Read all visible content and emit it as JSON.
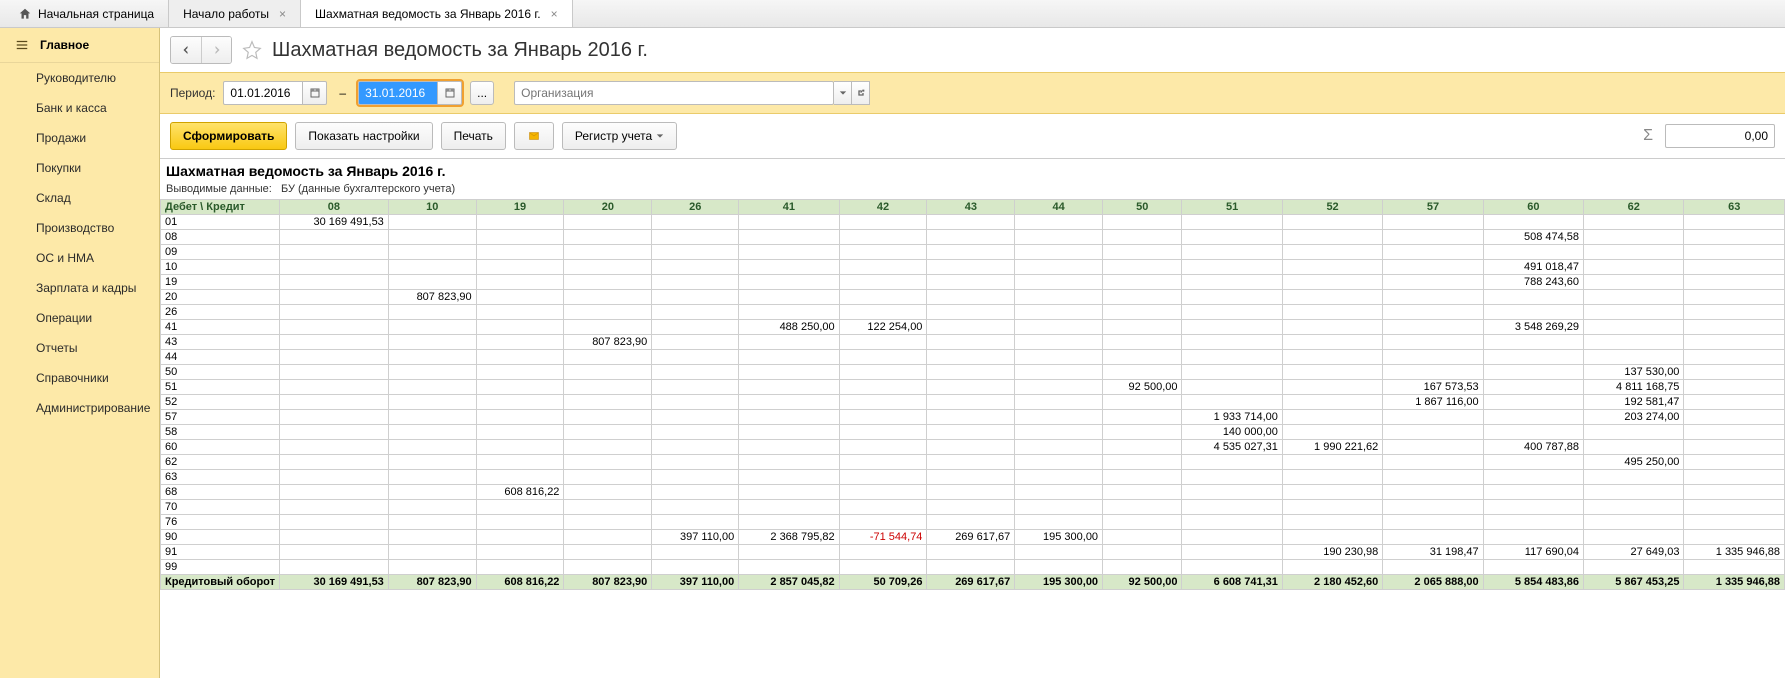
{
  "tabs": {
    "home": "Начальная страница",
    "items": [
      {
        "label": "Начало работы"
      },
      {
        "label": "Шахматная ведомость за Январь 2016 г.",
        "active": true
      }
    ]
  },
  "sidebar": {
    "main": "Главное",
    "items": [
      "Руководителю",
      "Банк и касса",
      "Продажи",
      "Покупки",
      "Склад",
      "Производство",
      "ОС и НМА",
      "Зарплата и кадры",
      "Операции",
      "Отчеты",
      "Справочники",
      "Администрирование"
    ]
  },
  "header": {
    "title": "Шахматная ведомость за Январь 2016 г."
  },
  "filter": {
    "period_label": "Период:",
    "from": "01.01.2016",
    "to": "31.01.2016",
    "org_placeholder": "Организация",
    "ellipsis": "..."
  },
  "toolbar": {
    "form": "Сформировать",
    "settings": "Показать настройки",
    "print": "Печать",
    "register": "Регистр учета",
    "sum": "0,00"
  },
  "report": {
    "title": "Шахматная ведомость за Январь 2016 г.",
    "sub_label": "Выводимые данные:",
    "sub_value": "БУ (данные бухгалтерского учета)",
    "row_header": "Дебет \\ Кредит",
    "columns": [
      "08",
      "10",
      "19",
      "20",
      "26",
      "41",
      "42",
      "43",
      "44",
      "50",
      "51",
      "52",
      "57",
      "60",
      "62",
      "63"
    ],
    "rows": [
      {
        "acc": "01",
        "cells": {
          "08": "30 169 491,53"
        }
      },
      {
        "acc": "08",
        "cells": {
          "60": "508 474,58"
        }
      },
      {
        "acc": "09",
        "cells": {}
      },
      {
        "acc": "10",
        "cells": {
          "60": "491 018,47"
        }
      },
      {
        "acc": "19",
        "cells": {
          "60": "788 243,60"
        }
      },
      {
        "acc": "20",
        "cells": {
          "10": "807 823,90"
        }
      },
      {
        "acc": "26",
        "cells": {}
      },
      {
        "acc": "41",
        "cells": {
          "41": "488 250,00",
          "42": "122 254,00",
          "60": "3 548 269,29"
        }
      },
      {
        "acc": "43",
        "cells": {
          "20": "807 823,90"
        }
      },
      {
        "acc": "44",
        "cells": {}
      },
      {
        "acc": "50",
        "cells": {
          "62": "137 530,00"
        }
      },
      {
        "acc": "51",
        "cells": {
          "50": "92 500,00",
          "57": "167 573,53",
          "62": "4 811 168,75"
        }
      },
      {
        "acc": "52",
        "cells": {
          "57": "1 867 116,00",
          "62": "192 581,47"
        }
      },
      {
        "acc": "57",
        "cells": {
          "51": "1 933 714,00",
          "62": "203 274,00"
        }
      },
      {
        "acc": "58",
        "cells": {
          "51": "140 000,00"
        }
      },
      {
        "acc": "60",
        "cells": {
          "51": "4 535 027,31",
          "52": "1 990 221,62",
          "60": "400 787,88"
        }
      },
      {
        "acc": "62",
        "cells": {
          "62": "495 250,00"
        }
      },
      {
        "acc": "63",
        "cells": {}
      },
      {
        "acc": "68",
        "cells": {
          "19": "608 816,22"
        }
      },
      {
        "acc": "70",
        "cells": {}
      },
      {
        "acc": "76",
        "cells": {}
      },
      {
        "acc": "90",
        "cells": {
          "26": "397 110,00",
          "41": "2 368 795,82",
          "42": "-71 544,74",
          "43": "269 617,67",
          "44": "195 300,00"
        }
      },
      {
        "acc": "91",
        "cells": {
          "52": "190 230,98",
          "57": "31 198,47",
          "60": "117 690,04",
          "62": "27 649,03",
          "63": "1 335 946,88"
        }
      },
      {
        "acc": "99",
        "cells": {}
      }
    ],
    "total_label": "Кредитовый оборот",
    "totals": {
      "08": "30 169 491,53",
      "10": "807 823,90",
      "19": "608 816,22",
      "20": "807 823,90",
      "26": "397 110,00",
      "41": "2 857 045,82",
      "42": "50 709,26",
      "43": "269 617,67",
      "44": "195 300,00",
      "50": "92 500,00",
      "51": "6 608 741,31",
      "52": "2 180 452,60",
      "57": "2 065 888,00",
      "60": "5 854 483,86",
      "62": "5 867 453,25",
      "63": "1 335 946,88"
    }
  }
}
